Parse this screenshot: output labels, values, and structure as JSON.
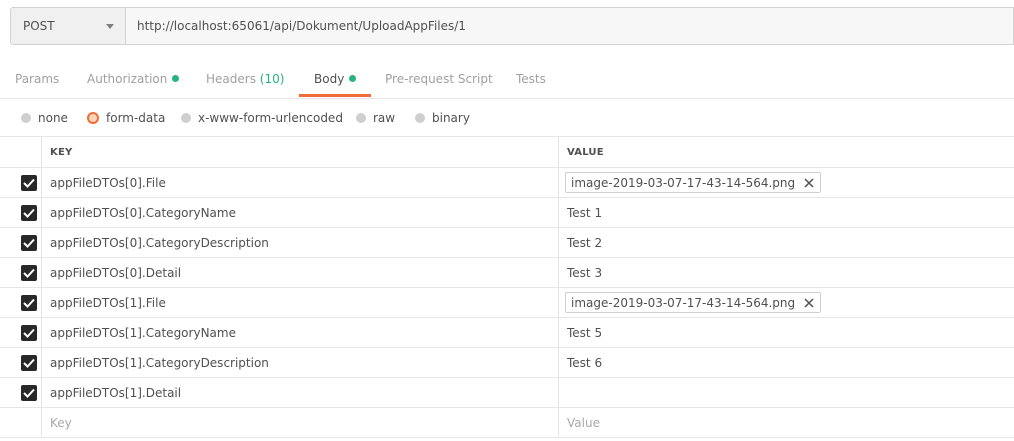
{
  "request": {
    "method": "POST",
    "url": "http://localhost:65061/api/Dokument/UploadAppFiles/1"
  },
  "tabs": [
    {
      "label": "Params"
    },
    {
      "label": "Authorization"
    },
    {
      "label": "Headers",
      "count": "(10)"
    },
    {
      "label": "Body"
    },
    {
      "label": "Pre-request Script"
    },
    {
      "label": "Tests"
    }
  ],
  "active_tab": "Body",
  "body_types": [
    {
      "label": "none"
    },
    {
      "label": "form-data"
    },
    {
      "label": "x-www-form-urlencoded"
    },
    {
      "label": "raw"
    },
    {
      "label": "binary"
    }
  ],
  "selected_body_type": "form-data",
  "table": {
    "headers": {
      "key": "KEY",
      "value": "VALUE"
    },
    "rows": [
      {
        "key": "appFileDTOs[0].File",
        "value": "image-2019-03-07-17-43-14-564.png",
        "type": "file",
        "checked": true
      },
      {
        "key": "appFileDTOs[0].CategoryName",
        "value": "Test 1",
        "type": "text",
        "checked": true
      },
      {
        "key": "appFileDTOs[0].CategoryDescription",
        "value": "Test 2",
        "type": "text",
        "checked": true
      },
      {
        "key": "appFileDTOs[0].Detail",
        "value": "Test 3",
        "type": "text",
        "checked": true
      },
      {
        "key": "appFileDTOs[1].File",
        "value": "image-2019-03-07-17-43-14-564.png",
        "type": "file",
        "checked": true
      },
      {
        "key": "appFileDTOs[1].CategoryName",
        "value": "Test 5",
        "type": "text",
        "checked": true
      },
      {
        "key": "appFileDTOs[1].CategoryDescription",
        "value": "Test 6",
        "type": "text",
        "checked": true
      },
      {
        "key": "appFileDTOs[1].Detail",
        "value": "",
        "type": "text",
        "checked": true
      }
    ],
    "new_row": {
      "key_placeholder": "Key",
      "value_placeholder": "Value"
    }
  },
  "colors": {
    "accent": "#f26b3a",
    "dot": "#26b47f"
  }
}
